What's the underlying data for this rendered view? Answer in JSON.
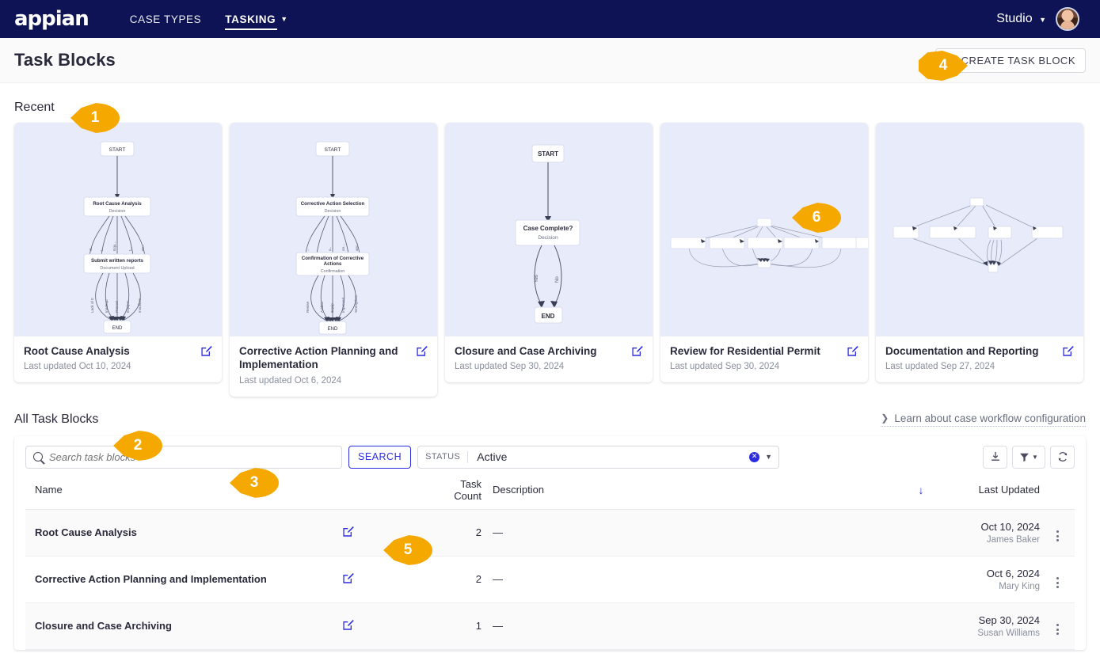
{
  "nav": {
    "logo": "appian",
    "links": [
      {
        "label": "CASE TYPES",
        "active": false
      },
      {
        "label": "TASKING",
        "active": true
      }
    ],
    "studio_label": "Studio"
  },
  "header": {
    "title": "Task Blocks",
    "create_button": "CREATE TASK BLOCK"
  },
  "recent": {
    "label": "Recent",
    "cards": [
      {
        "title": "Root Cause Analysis",
        "date": "Last updated Oct 10, 2024",
        "diagram": {
          "start": "START",
          "nodes": [
            {
              "name": "Root Cause Analysis",
              "type": "Decision"
            },
            {
              "name": "Submit written reports",
              "type": "Document Upload"
            }
          ],
          "end": "END",
          "edge_labels": [
            "Lack of tr...",
            "Inadequ...",
            "Proced...",
            "Equipm...",
            "Insufficie..."
          ]
        }
      },
      {
        "title": "Corrective Action Planning and Implementation",
        "date": "Last updated Oct 6, 2024",
        "diagram": {
          "start": "START",
          "nodes": [
            {
              "name": "Corrective Action Selection",
              "type": "Decision"
            },
            {
              "name": "Confirmation of Corrective Actions",
              "type": "Confirmation"
            }
          ],
          "end": "END",
          "edge_labels": [
            "Revise",
            "Additio...",
            "Equip...",
            "Improved",
            "Strengthen"
          ]
        }
      },
      {
        "title": "Closure and Case Archiving",
        "date": "Last updated Sep 30, 2024",
        "diagram": {
          "start": "START",
          "nodes": [
            {
              "name": "Case Complete?",
              "type": "Decision"
            }
          ],
          "end": "END",
          "edge_labels": [
            "Yes",
            "No"
          ]
        }
      },
      {
        "title": "Review for Residential Permit",
        "date": "Last updated Sep 30, 2024",
        "diagram": {
          "start": "",
          "nodes": [],
          "end": "",
          "edge_labels": []
        }
      },
      {
        "title": "Documentation and Reporting",
        "date": "Last updated Sep 27, 2024",
        "diagram": {
          "start": "",
          "nodes": [],
          "end": "",
          "edge_labels": []
        }
      }
    ]
  },
  "all_blocks": {
    "label": "All Task Blocks",
    "learn_link": "Learn about case workflow configuration",
    "search": {
      "placeholder": "Search task blocks",
      "value": "",
      "button": "SEARCH"
    },
    "status_filter": {
      "label": "STATUS",
      "value": "Active"
    },
    "columns": {
      "name": "Name",
      "task_count": "Task Count",
      "description": "Description",
      "last_updated": "Last Updated"
    },
    "rows": [
      {
        "name": "Root Cause Analysis",
        "task_count": "2",
        "description": "—",
        "date": "Oct 10, 2024",
        "user": "James Baker"
      },
      {
        "name": "Corrective Action Planning and Implementation",
        "task_count": "2",
        "description": "—",
        "date": "Oct 6, 2024",
        "user": "Mary King"
      },
      {
        "name": "Closure and Case Archiving",
        "task_count": "1",
        "description": "—",
        "date": "Sep 30, 2024",
        "user": "Susan Williams"
      }
    ]
  },
  "callouts": {
    "c1": "1",
    "c2": "2",
    "c3": "3",
    "c4": "4",
    "c5": "5",
    "c6": "6"
  },
  "colors": {
    "navy": "#0d1354",
    "accent_blue": "#2d2de0",
    "callout_orange": "#f5a800",
    "thumb_bg": "#e7ebfa"
  }
}
